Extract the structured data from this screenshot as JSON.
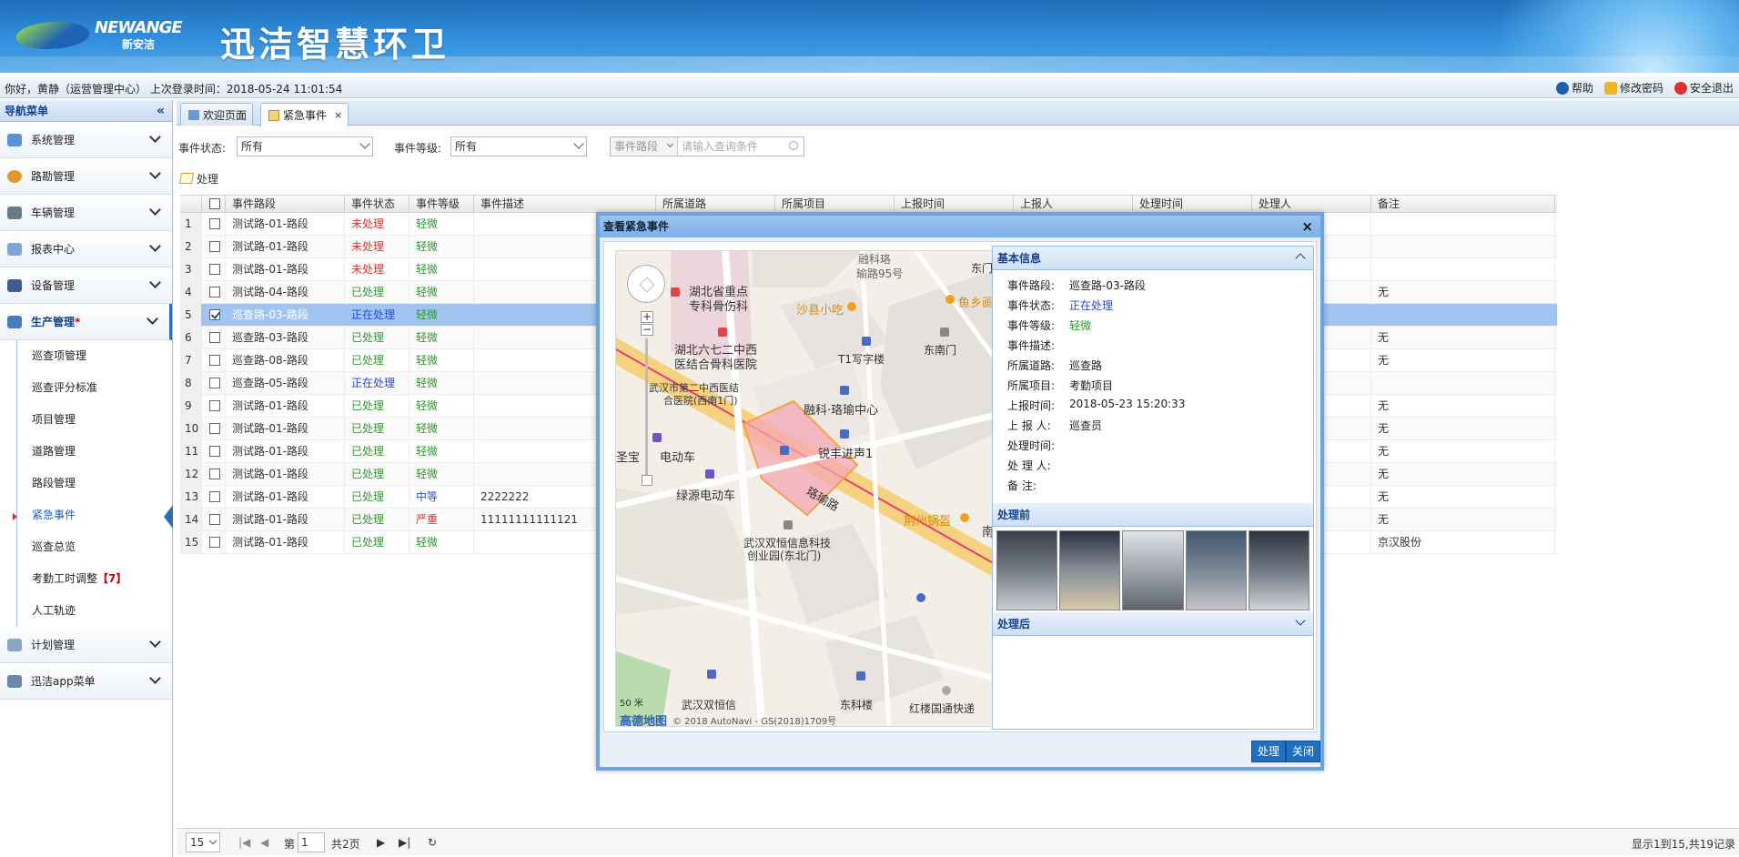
{
  "header": {
    "brand_en": "NEWANGE",
    "brand_cn": "新安洁",
    "system_title": "迅洁智慧环卫"
  },
  "infobar": {
    "greeting": "你好，黄静（运营管理中心） 上次登录时间：2018-05-24 11:01:54",
    "help": "帮助",
    "change_password": "修改密码",
    "logout": "安全退出"
  },
  "sidebar": {
    "title": "导航菜单",
    "collapse_glyph": "«",
    "groups": [
      {
        "label": "系统管理"
      },
      {
        "label": "路勘管理"
      },
      {
        "label": "车辆管理"
      },
      {
        "label": "报表中心"
      },
      {
        "label": "设备管理"
      },
      {
        "label": "生产管理",
        "marker": "*"
      },
      {
        "label": "计划管理"
      },
      {
        "label": "迅洁app菜单"
      }
    ],
    "sub_items": [
      {
        "label": "巡查项管理"
      },
      {
        "label": "巡查评分标准"
      },
      {
        "label": "项目管理"
      },
      {
        "label": "道路管理"
      },
      {
        "label": "路段管理"
      },
      {
        "label": "紧急事件"
      },
      {
        "label": "巡查总览"
      },
      {
        "label": "考勤工时调整",
        "badge": "【7】"
      },
      {
        "label": "人工轨迹"
      }
    ]
  },
  "tabs": [
    {
      "label": "欢迎页面"
    },
    {
      "label": "紧急事件",
      "close": "×"
    }
  ],
  "filters": {
    "status_label": "事件状态:",
    "status_value": "所有",
    "level_label": "事件等级:",
    "level_value": "所有",
    "search_kind": "事件路段",
    "search_placeholder": "请输入查询条件"
  },
  "toolbar": {
    "process_label": "处理"
  },
  "grid": {
    "columns": [
      "事件路段",
      "事件状态",
      "事件等级",
      "事件描述",
      "所属道路",
      "所属项目",
      "上报时间",
      "上报人",
      "处理时间",
      "处理人",
      "备注"
    ],
    "rows": [
      {
        "no": "1",
        "road_section": "测试路-01-路段",
        "status": "未处理",
        "level": "轻微",
        "desc": "",
        "remark": ""
      },
      {
        "no": "2",
        "road_section": "测试路-01-路段",
        "status": "未处理",
        "level": "轻微",
        "desc": "",
        "remark": ""
      },
      {
        "no": "3",
        "road_section": "测试路-01-路段",
        "status": "未处理",
        "level": "轻微",
        "desc": "",
        "remark": ""
      },
      {
        "no": "4",
        "road_section": "测试路-04-路段",
        "status": "已处理",
        "level": "轻微",
        "desc": "",
        "remark": "无"
      },
      {
        "no": "5",
        "road_section": "巡查路-03-路段",
        "status": "正在处理",
        "level": "轻微",
        "desc": "",
        "remark": ""
      },
      {
        "no": "6",
        "road_section": "巡查路-03-路段",
        "status": "已处理",
        "level": "轻微",
        "desc": "",
        "remark": "无"
      },
      {
        "no": "7",
        "road_section": "巡查路-08-路段",
        "status": "已处理",
        "level": "轻微",
        "desc": "",
        "remark": "无"
      },
      {
        "no": "8",
        "road_section": "巡查路-05-路段",
        "status": "正在处理",
        "level": "轻微",
        "desc": "",
        "remark": ""
      },
      {
        "no": "9",
        "road_section": "测试路-01-路段",
        "status": "已处理",
        "level": "轻微",
        "desc": "",
        "remark": "无"
      },
      {
        "no": "10",
        "road_section": "测试路-01-路段",
        "status": "已处理",
        "level": "轻微",
        "desc": "",
        "remark": "无"
      },
      {
        "no": "11",
        "road_section": "测试路-01-路段",
        "status": "已处理",
        "level": "轻微",
        "desc": "",
        "remark": "无"
      },
      {
        "no": "12",
        "road_section": "测试路-01-路段",
        "status": "已处理",
        "level": "轻微",
        "desc": "",
        "remark": "无"
      },
      {
        "no": "13",
        "road_section": "测试路-01-路段",
        "status": "已处理",
        "level": "中等",
        "desc": "2222222",
        "remark": "无"
      },
      {
        "no": "14",
        "road_section": "测试路-01-路段",
        "status": "已处理",
        "level": "严重",
        "desc": "11111111111121",
        "remark": "无"
      },
      {
        "no": "15",
        "road_section": "测试路-01-路段",
        "status": "已处理",
        "level": "轻微",
        "desc": "",
        "remark": "京汉股份"
      }
    ]
  },
  "pager": {
    "page_size": "15",
    "page_prefix": "第",
    "page_number": "1",
    "page_total": "共2页",
    "info": "显示1到15,共19记录"
  },
  "modal": {
    "title": "查看紧急事件",
    "close": "×",
    "process_button": "处理",
    "close_button": "关闭",
    "basic_info_title": "基本信息",
    "fields": [
      {
        "label": "事件路段:",
        "value": "巡查路-03-路段",
        "style": ""
      },
      {
        "label": "事件状态:",
        "value": "正在处理",
        "style": "blue"
      },
      {
        "label": "事件等级:",
        "value": "轻微",
        "style": "green"
      },
      {
        "label": "事件描述:",
        "value": "",
        "style": ""
      },
      {
        "label": "所属道路:",
        "value": "巡查路",
        "style": ""
      },
      {
        "label": "所属项目:",
        "value": "考勤项目",
        "style": ""
      },
      {
        "label": "上报时间:",
        "value": "2018-05-23 15:20:33",
        "style": ""
      },
      {
        "label": "上 报 人:",
        "value": "巡查员",
        "style": ""
      },
      {
        "label": "处理时间:",
        "value": "",
        "style": ""
      },
      {
        "label": "处 理 人:",
        "value": "",
        "style": ""
      },
      {
        "label": "备    注:",
        "value": "",
        "style": ""
      }
    ],
    "before_title": "处理前",
    "after_title": "处理后"
  },
  "map": {
    "labels": {
      "l1": "融科珞",
      "l2": "瑜路95号",
      "l3": "东门",
      "l4": "湖北省重点",
      "l5": "专科骨伤科",
      "l6": "沙县小吃",
      "l7": "鱼乡画",
      "l8": "湖北六七二中西",
      "l9": "医结合骨科医院",
      "l10": "T1写字楼",
      "l11": "东南门",
      "l12": "武汉市第二中西医结",
      "l13": "合医院(西南1门)",
      "l14": "融科·珞瑜中心",
      "l15": "锐丰进声1",
      "l16": "圣宝",
      "l17": "电动车",
      "l18": "绿源电动车",
      "l19": "珞瑜路",
      "l20": "荆州锅盔",
      "l21": "南",
      "l22": "武汉双恒信息科技",
      "l23": "创业园(东北门)",
      "l24": "武汉双恒信",
      "l25": "东科楼",
      "l26": "红楼国通快递"
    },
    "zoom_in": "+",
    "zoom_out": "−",
    "scale": "50 米",
    "brand": "高德地图",
    "copyright": "© 2018 AutoNavi - GS(2018)1709号"
  },
  "colors": {
    "header_blue": "#2f8ad8",
    "selected_row": "#9fc5f0",
    "status_unprocessed": "#e03030",
    "status_processed": "#2e9a2e",
    "status_processing": "#2a46d8",
    "button_blue": "#1f6fc2"
  }
}
